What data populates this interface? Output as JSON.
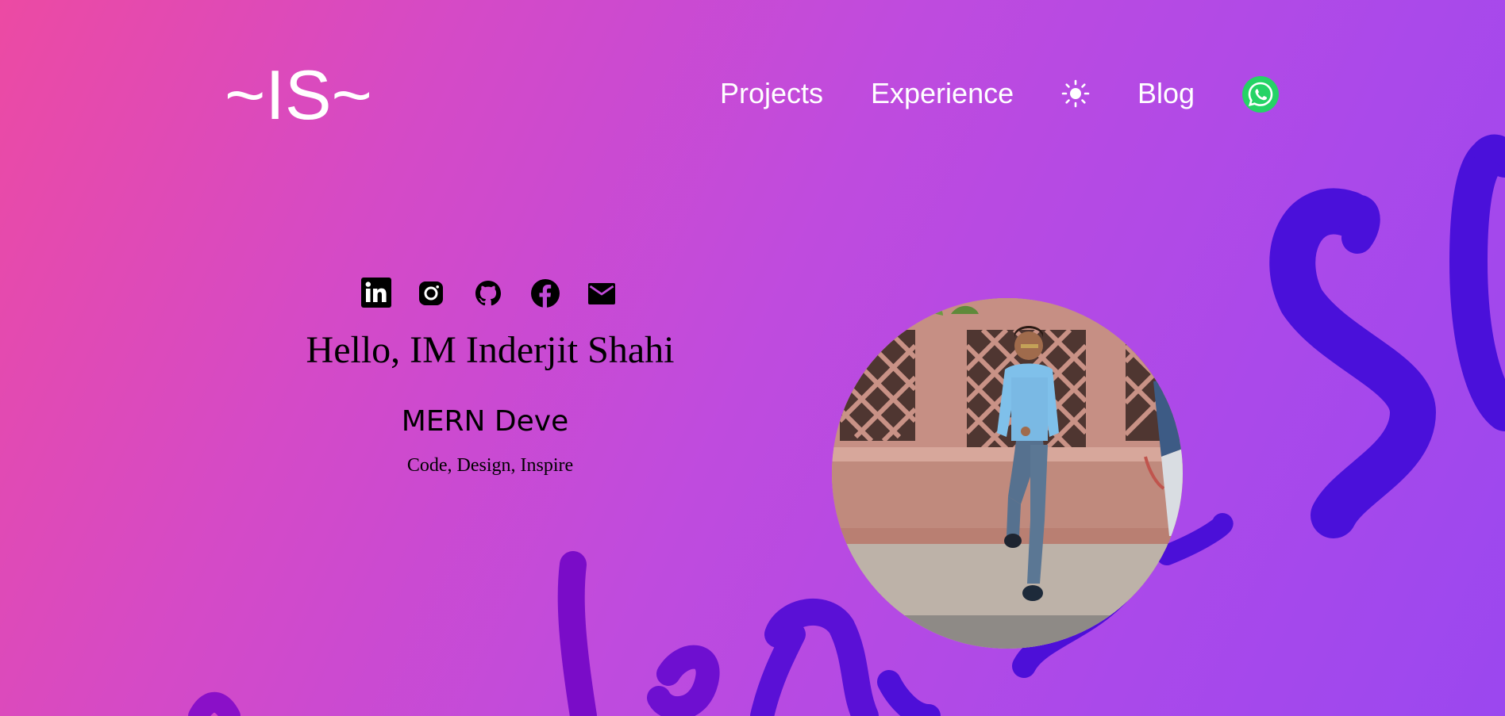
{
  "header": {
    "logo": "~IS~",
    "nav": {
      "projects": "Projects",
      "experience": "Experience",
      "blog": "Blog"
    },
    "theme_toggle_icon": "sun-icon",
    "whatsapp_icon": "whatsapp-icon"
  },
  "socials": [
    {
      "name": "linkedin",
      "icon": "linkedin-icon"
    },
    {
      "name": "instagram",
      "icon": "instagram-icon"
    },
    {
      "name": "github",
      "icon": "github-icon"
    },
    {
      "name": "facebook",
      "icon": "facebook-icon"
    },
    {
      "name": "email",
      "icon": "mail-icon"
    }
  ],
  "hero": {
    "greeting": "Hello, IM Inderjit Shahi",
    "role": "MERN Deve",
    "tagline": "Code, Design, Inspire"
  },
  "colors": {
    "gradient_start": "#ec4aa3",
    "gradient_end": "#9b47ef",
    "brush_text": "#4a0fd8",
    "whatsapp_green": "#25d366",
    "nav_text": "#ffffff"
  }
}
